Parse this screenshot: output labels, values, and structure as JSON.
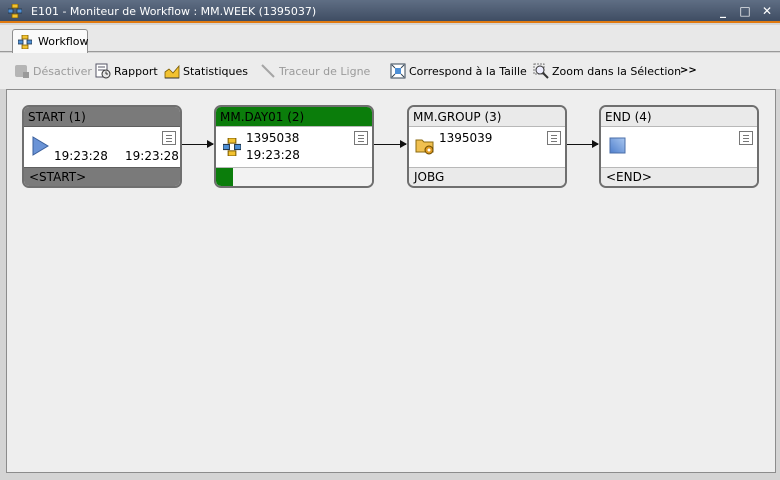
{
  "window": {
    "title": "E101 - Moniteur de Workflow : MM.WEEK (1395037)",
    "minimize": "_",
    "maximize": "□",
    "close": "✕"
  },
  "tabs": [
    {
      "label": "Workflow",
      "icon": "workflow-icon",
      "active": true
    }
  ],
  "toolbar": {
    "deactivate": "Désactiver",
    "report": "Rapport",
    "statistics": "Statistiques",
    "line_tracer": "Traceur de Ligne",
    "fit_size": "Correspond à la Taille",
    "zoom_selection": "Zoom dans la Sélection",
    "more": ">>"
  },
  "nodes": [
    {
      "title": "START (1)",
      "start_time": "19:23:28",
      "end_time": "19:23:28",
      "footer": "<START>",
      "icon": "play-icon"
    },
    {
      "title": "MM.DAY01 (2)",
      "run_id": "1395038",
      "time": "19:23:28",
      "footer": "",
      "progress": 0.11,
      "icon": "workflow-icon"
    },
    {
      "title": "MM.GROUP (3)",
      "run_id": "1395039",
      "footer": "JOBG",
      "icon": "job-group-folder-icon"
    },
    {
      "title": "END (4)",
      "footer": "<END>",
      "icon": "end-icon"
    }
  ],
  "colors": {
    "accent": "#e07a10",
    "running": "#0b7d0b",
    "start_node": "#7a7a7a"
  }
}
